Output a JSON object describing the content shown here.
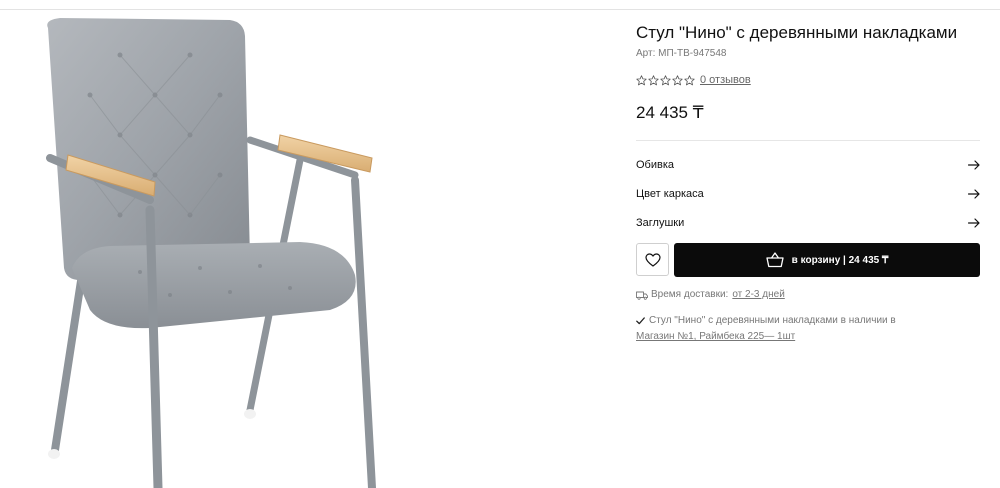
{
  "product": {
    "title": "Стул \"Нино\" с деревянными накладками",
    "sku_label": "Арт:",
    "sku_value": "МП-ТВ-947548",
    "rating_stars": 0,
    "reviews_link": "0 отзывов",
    "price": "24 435 ₸"
  },
  "options": [
    {
      "label": "Обивка",
      "icon": "arrow-right-icon"
    },
    {
      "label": "Цвет каркаса",
      "icon": "arrow-right-icon"
    },
    {
      "label": "Заглушки",
      "icon": "arrow-right-icon"
    }
  ],
  "actions": {
    "favorite_icon": "heart-icon",
    "cart_icon": "basket-icon",
    "cart_label": "в корзину | 24 435 ₸"
  },
  "delivery": {
    "icon": "truck-icon",
    "label": "Время доставки:",
    "value": "от 2-3 дней"
  },
  "stock": {
    "icon": "check-icon",
    "text": "Стул \"Нино\" с деревянными накладками в наличии в",
    "store_link": "Магазин №1, Раймбека 225— 1шт"
  },
  "colors": {
    "cart_button": "#0b0b0b",
    "upholstery": "#9aa0a6",
    "frame": "#8e949a",
    "armrest_wood": "#e8c48f"
  }
}
